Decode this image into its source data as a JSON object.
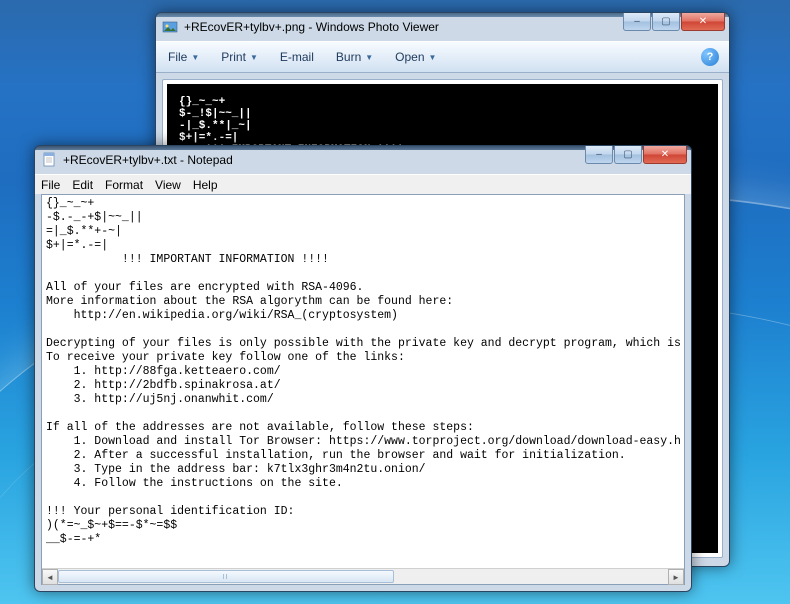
{
  "photoViewer": {
    "title": "+REcovER+tylbv+.png - Windows Photo Viewer",
    "toolbar": {
      "file": "File",
      "print": "Print",
      "email": "E-mail",
      "burn": "Burn",
      "open": "Open"
    },
    "content": "{}_~_~+\n$-_!$|~~_||\n-|_$.**|_~|\n$+|=*.-=|\n    !!! IMPORTANT INFORMATION !!!!\n\nAll of your files are encrypted with RSA-4096.\nMore information about the RSA algorythm can be found here:\n   http://en.wikipedia.org/wiki/RSA_(cryptosystem)"
  },
  "notepad": {
    "title": "+REcovER+tylbv+.txt - Notepad",
    "menu": {
      "file": "File",
      "edit": "Edit",
      "format": "Format",
      "view": "View",
      "help": "Help"
    },
    "content": "{}_~_~+\n-$.-_-+$|~~_||\n=|_$.**+-~|\n$+|=*.-=|\n           !!! IMPORTANT INFORMATION !!!!\n\nAll of your files are encrypted with RSA-4096.\nMore information about the RSA algorythm can be found here:\n    http://en.wikipedia.org/wiki/RSA_(cryptosystem)\n\nDecrypting of your files is only possible with the private key and decrypt program, which is\nTo receive your private key follow one of the links:\n    1. http://88fga.ketteaero.com/\n    2. http://2bdfb.spinakrosa.at/\n    3. http://uj5nj.onanwhit.com/\n\nIf all of the addresses are not available, follow these steps:\n    1. Download and install Tor Browser: https://www.torproject.org/download/download-easy.h\n    2. After a successful installation, run the browser and wait for initialization.\n    3. Type in the address bar: k7tlx3ghr3m4n2tu.onion/\n    4. Follow the instructions on the site.\n\n!!! Your personal identification ID:\n)(*=~_$~+$==-$*~=$$\n__$-=-+*"
  },
  "winControls": {
    "minimize": "–",
    "maximize": "▢",
    "close": "✕"
  }
}
